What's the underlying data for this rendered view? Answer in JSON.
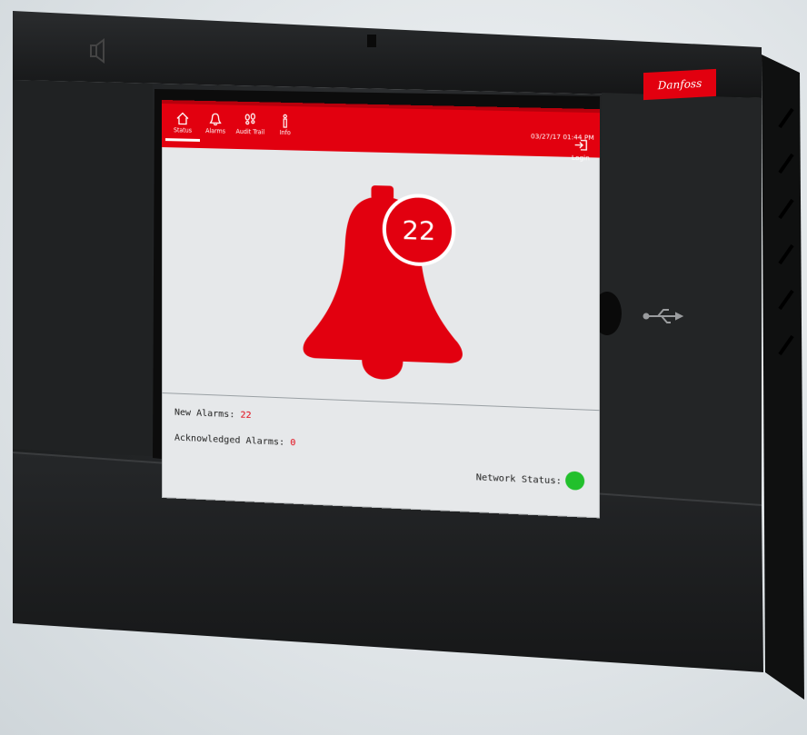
{
  "brand": {
    "logo_text": "Danfoss",
    "color": "#e2000f"
  },
  "nav": {
    "items": [
      {
        "label": "Status",
        "icon": "home-icon",
        "active": true
      },
      {
        "label": "Alarms",
        "icon": "bell-icon",
        "active": false
      },
      {
        "label": "Audit Trail",
        "icon": "footprints-icon",
        "active": false
      },
      {
        "label": "Info",
        "icon": "info-icon",
        "active": false
      }
    ]
  },
  "header": {
    "datetime": "03/27/17 01:44 PM",
    "login_label": "Login"
  },
  "alarm": {
    "badge_count": "22"
  },
  "summary": {
    "new_alarms_label": "New Alarms: ",
    "new_alarms_value": "22",
    "ack_alarms_label": "Acknowledged Alarms: ",
    "ack_alarms_value": "0",
    "network_label": "Network Status:",
    "network_state_color": "#22c02c"
  }
}
